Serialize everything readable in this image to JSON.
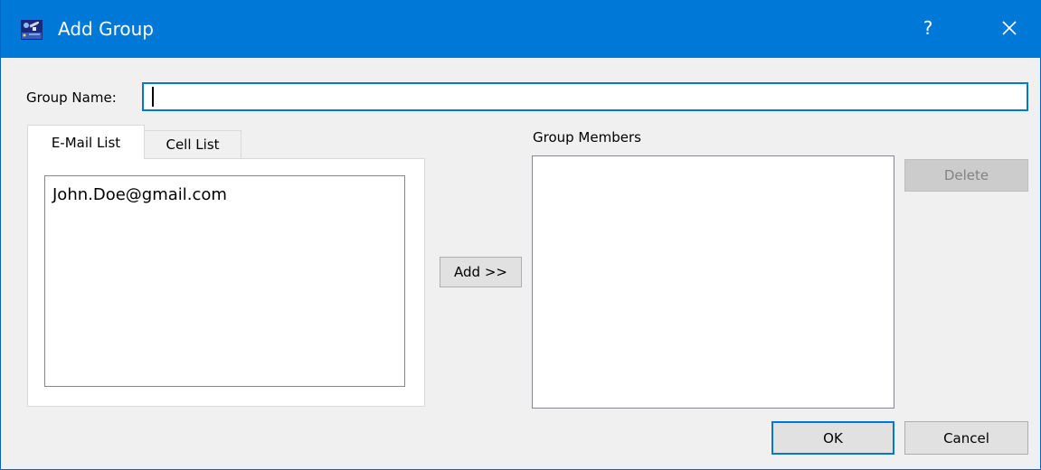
{
  "window": {
    "title": "Add Group",
    "help_label": "?",
    "icons": {
      "app": "satellite-app-icon",
      "close": "close-icon"
    }
  },
  "form": {
    "group_name_label": "Group Name:",
    "group_name_value": "",
    "group_name_placeholder": ""
  },
  "tabs": [
    {
      "label": "E-Mail List",
      "active": true
    },
    {
      "label": "Cell List",
      "active": false
    }
  ],
  "email_list": {
    "items": [
      "John.Doe@gmail.com"
    ]
  },
  "buttons": {
    "add_label": "Add >>",
    "delete_label": "Delete",
    "ok_label": "OK",
    "cancel_label": "Cancel"
  },
  "members": {
    "label": "Group Members",
    "items": []
  },
  "colors": {
    "titlebar": "#0078d7",
    "focus_border": "#0078d7",
    "window_bg": "#f0f0f0",
    "disabled_text": "#838383"
  }
}
